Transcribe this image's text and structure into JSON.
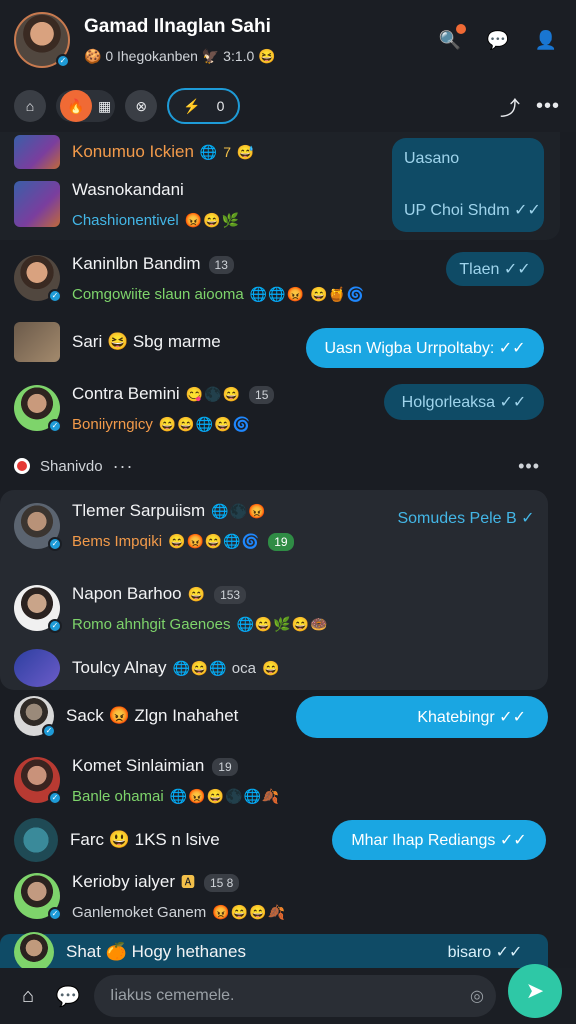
{
  "header": {
    "title": "Gamad Ilnaglan Sahi",
    "subtitle": "🍪 0 Ihegokanben 🦅 3:1.0 😆"
  },
  "toolbar": {
    "active_tab_icon": "⚡",
    "active_tab_count": "0"
  },
  "feed": {
    "top_section": [
      {
        "name": "Konumuo Ickien",
        "emojis": "🌐 7 😅"
      },
      {
        "name": "Wasnokandani",
        "sub": "Chashionentivel",
        "emojis": "😡😄🌿"
      }
    ],
    "top_tile": {
      "title": "Uasano",
      "footer": "UP Choi Shdm ✓✓"
    },
    "section1": [
      {
        "name": "Kaninlbn Bandim",
        "badge": "13",
        "sub": "Comgowiite slaun aiooma",
        "emojis": "🌐🌐😡 😄🍯🌀",
        "bubble": "Tlaen ✓✓"
      },
      {
        "name": "Sari 😆 Sbg marme",
        "bubble": "Uasn Wigba Urrpoltaby: ✓✓"
      },
      {
        "name": "Contra Bemini",
        "badge": "15",
        "name_emojis": "😋🌑😄",
        "sub": "Boniiyrngicy",
        "emojis": "😄😄🌐😄🌀",
        "bubble": "Holgorleaksa ✓✓"
      }
    ],
    "divider": {
      "label": "Shanivdo"
    },
    "card": [
      {
        "name": "Tlemer Sarpuiism",
        "name_emojis": "🌐🌑😡",
        "sub": "Bems Impqiki",
        "emojis": "😄😡😄🌐🌀",
        "badge": "19",
        "bubble": "Somudes Pele B ✓"
      },
      {
        "name": "Napon Barhoo",
        "name_emojis": "😄",
        "badge": "153",
        "sub": "Romo ahnhgit Gaenoes",
        "emojis": "🌐😄🌿😄🍩"
      },
      {
        "name": "Toulcy Alnay",
        "name_emojis": "🌐😄🌐",
        "sub_inline": "oca",
        "emojis": "😄"
      }
    ],
    "section2": [
      {
        "name": "Sack 😡 Zlgn Inahahet",
        "bubble": "Khatebingr ✓✓"
      },
      {
        "name": "Komet Sinlaimian",
        "badge": "19",
        "sub": "Banle ohamai",
        "emojis": "🌐😡😄🌑🌐🍂"
      },
      {
        "name": "Farc 😃 1KS n lsive",
        "bubble": "Mhar Ihap Rediangs ✓✓"
      },
      {
        "name": "Kerioby ialyer",
        "name_emojis": "🅰",
        "badge": "15 8",
        "sub": "Ganlemoket Ganem",
        "emojis": "😡😄😄🍂"
      },
      {
        "name": "Shat 🍊 Hogy hethanes",
        "bubble": "bisaro ✓✓"
      }
    ]
  },
  "composer": {
    "placeholder": "Iiakus cememele."
  },
  "colors": {
    "accent": "#1aa6e2",
    "fab": "#2ec8a6",
    "bg": "#1a1d23"
  }
}
